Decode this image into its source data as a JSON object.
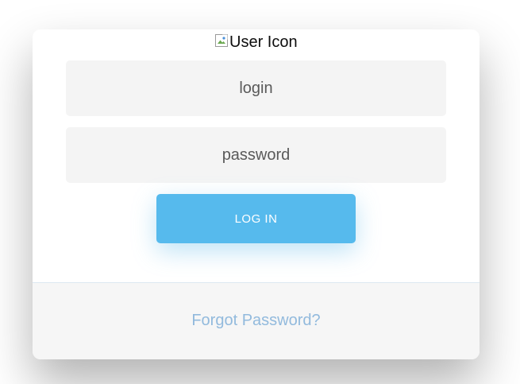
{
  "header": {
    "user_icon_alt": "User Icon"
  },
  "form": {
    "login_placeholder": "login",
    "password_placeholder": "password",
    "submit_label": "LOG IN"
  },
  "footer": {
    "forgot_password_label": "Forgot Password?"
  },
  "colors": {
    "accent": "#56baed",
    "link": "#92badd",
    "field_bg": "#f4f4f4",
    "footer_bg": "#f6f6f6"
  },
  "icons": {
    "user": "broken-image-icon"
  }
}
